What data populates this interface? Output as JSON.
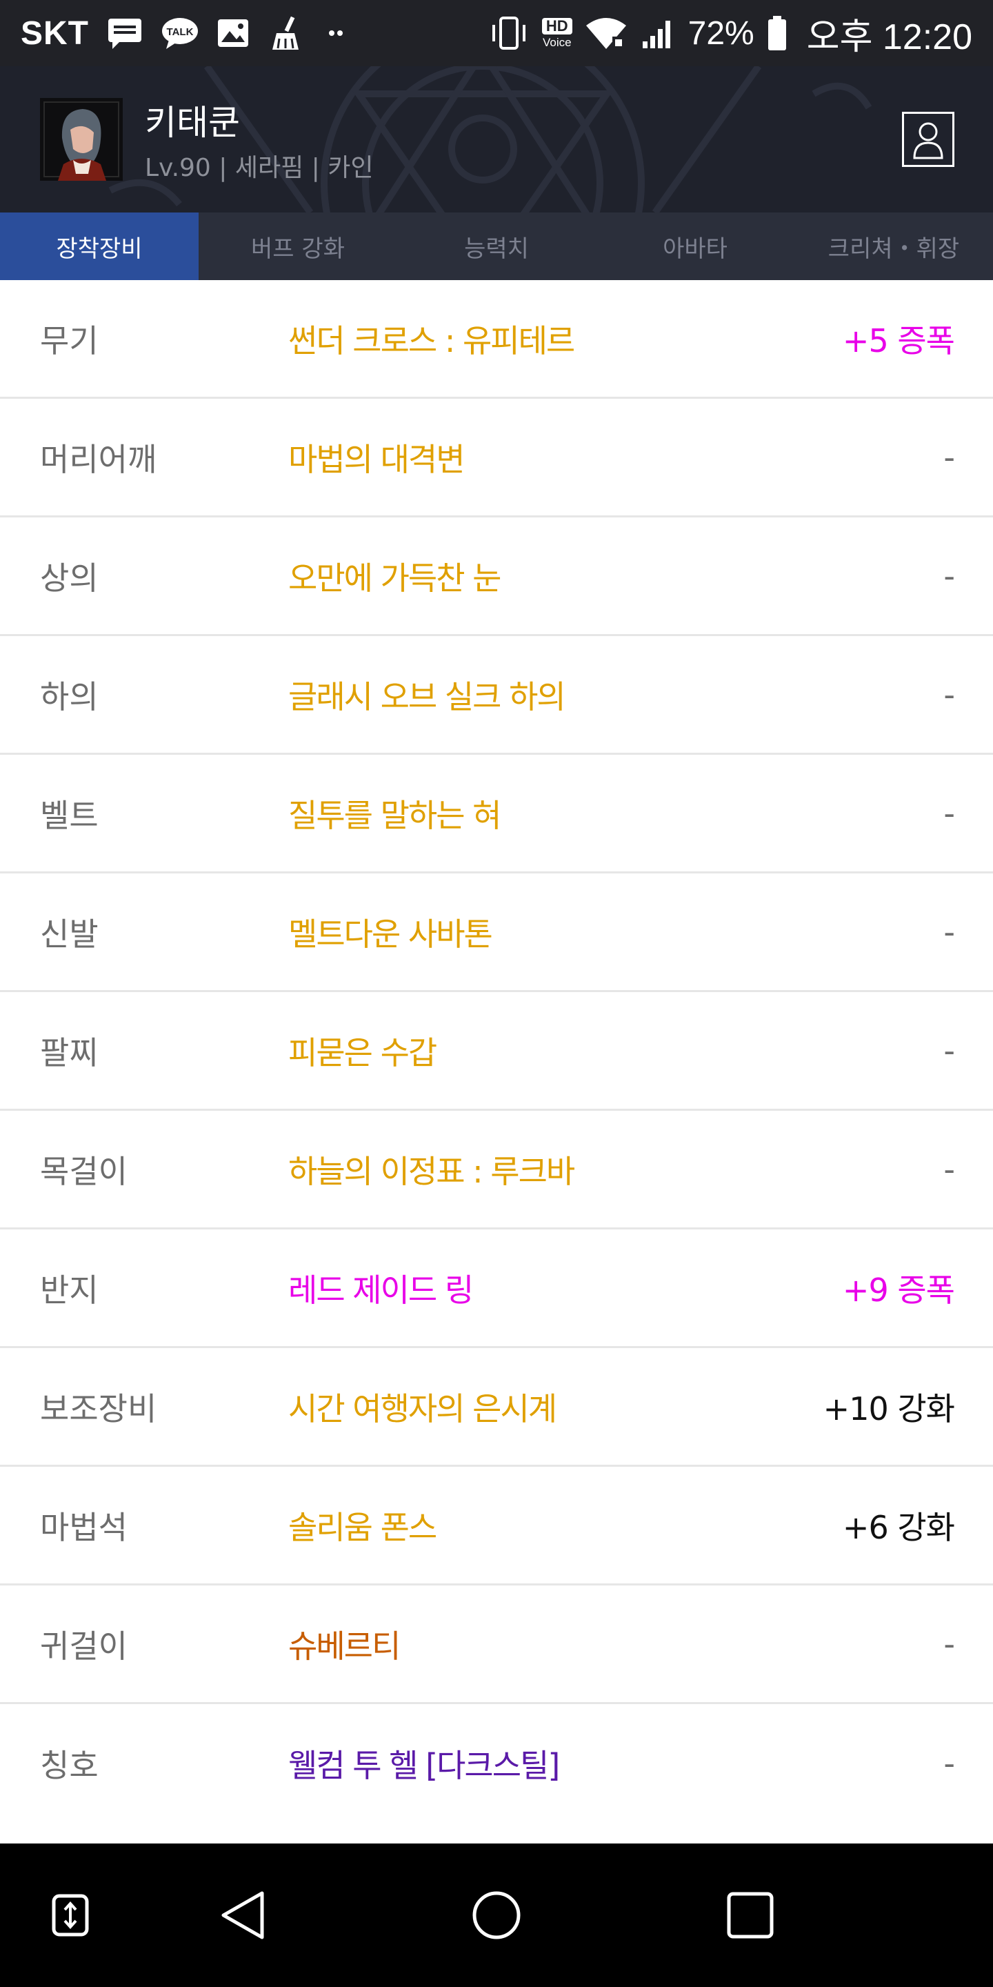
{
  "status_bar": {
    "carrier": "SKT",
    "icons": [
      "message-icon",
      "kakaotalk-icon",
      "image-icon",
      "cleaner-icon",
      "more-dots-icon",
      "vibrate-icon",
      "hd-voice-icon",
      "wifi-icon",
      "signal-icon",
      "battery-icon"
    ],
    "hd_label": "HD",
    "voice_label": "Voice",
    "talk_label": "TALK",
    "battery": "72%",
    "time": "오후 12:20"
  },
  "profile": {
    "name": "키태쿤",
    "meta": "Lv.90 | 세라핌 | 카인",
    "avatar_icon": "character-avatar",
    "action_icon": "profile-card-icon"
  },
  "tabs": [
    {
      "label": "장착장비",
      "active": true
    },
    {
      "label": "버프 강화",
      "active": false
    },
    {
      "label": "능력치",
      "active": false
    },
    {
      "label": "아바타",
      "active": false
    },
    {
      "label": "크리쳐・휘장",
      "active": false
    }
  ],
  "equipment": [
    {
      "slot": "무기",
      "item": "썬더 크로스 : 유피테르",
      "item_color": "#e0a000",
      "enh": "+5 증폭",
      "enh_color": "#e800e8"
    },
    {
      "slot": "머리어깨",
      "item": "마법의 대격변",
      "item_color": "#e0a000",
      "enh": "-",
      "enh_color": "#6d6d6d"
    },
    {
      "slot": "상의",
      "item": "오만에 가득찬 눈",
      "item_color": "#e0a000",
      "enh": "-",
      "enh_color": "#6d6d6d"
    },
    {
      "slot": "하의",
      "item": "글래시 오브 실크 하의",
      "item_color": "#e0a000",
      "enh": "-",
      "enh_color": "#6d6d6d"
    },
    {
      "slot": "벨트",
      "item": "질투를 말하는 혀",
      "item_color": "#e0a000",
      "enh": "-",
      "enh_color": "#6d6d6d"
    },
    {
      "slot": "신발",
      "item": "멜트다운 사바톤",
      "item_color": "#e0a000",
      "enh": "-",
      "enh_color": "#6d6d6d"
    },
    {
      "slot": "팔찌",
      "item": "피묻은 수갑",
      "item_color": "#e0a000",
      "enh": "-",
      "enh_color": "#6d6d6d"
    },
    {
      "slot": "목걸이",
      "item": "하늘의 이정표 : 루크바",
      "item_color": "#e0a000",
      "enh": "-",
      "enh_color": "#6d6d6d"
    },
    {
      "slot": "반지",
      "item": "레드 제이드 링",
      "item_color": "#e800e8",
      "enh": "+9 증폭",
      "enh_color": "#e800e8"
    },
    {
      "slot": "보조장비",
      "item": "시간 여행자의 은시계",
      "item_color": "#e0a000",
      "enh": "+10 강화",
      "enh_color": "#111111"
    },
    {
      "slot": "마법석",
      "item": "솔리움 폰스",
      "item_color": "#e0a000",
      "enh": "+6 강화",
      "enh_color": "#111111"
    },
    {
      "slot": "귀걸이",
      "item": "슈베르티",
      "item_color": "#c75d00",
      "enh": "-",
      "enh_color": "#6d6d6d"
    },
    {
      "slot": "칭호",
      "item": "웰컴 투 헬 [다크스틸]",
      "item_color": "#5a1aa8",
      "enh": "-",
      "enh_color": "#6d6d6d"
    }
  ],
  "nav": {
    "icons": [
      "app-switch-icon",
      "back-icon",
      "home-icon",
      "recents-icon"
    ]
  }
}
